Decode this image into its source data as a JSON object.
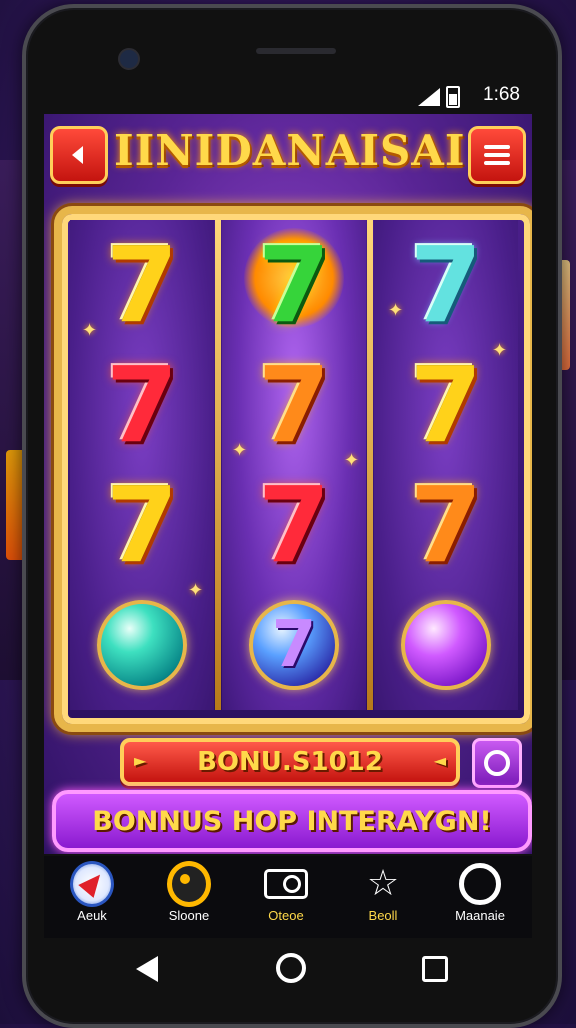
{
  "status_bar": {
    "time": "1:68"
  },
  "game": {
    "title": "IINIDANAISAI",
    "back_icon": "chevron-left-icon",
    "menu_icon": "hamburger-menu-icon",
    "accent_color": "#ffd94a",
    "frame_color": "#e7b64a"
  },
  "reels": [
    {
      "symbols": [
        {
          "kind": "seven",
          "color": "yellow",
          "text": "7"
        },
        {
          "kind": "seven",
          "color": "red",
          "text": "7"
        },
        {
          "kind": "seven",
          "color": "yellow",
          "text": "7"
        },
        {
          "kind": "orb",
          "color": "teal",
          "text": ""
        }
      ]
    },
    {
      "symbols": [
        {
          "kind": "seven",
          "color": "green",
          "text": "7"
        },
        {
          "kind": "seven",
          "color": "orange",
          "text": "7"
        },
        {
          "kind": "seven",
          "color": "red",
          "text": "7"
        },
        {
          "kind": "orb",
          "color": "mixed",
          "text": "7"
        }
      ]
    },
    {
      "symbols": [
        {
          "kind": "seven",
          "color": "cyan",
          "text": "7"
        },
        {
          "kind": "seven",
          "color": "yellow",
          "text": "7"
        },
        {
          "kind": "seven",
          "color": "orange",
          "text": "7"
        },
        {
          "kind": "orb",
          "color": "purple",
          "text": ""
        }
      ]
    }
  ],
  "bonus": {
    "label": "BONU.S1012"
  },
  "promo": {
    "label": "BONNUS HOP INTERAYGN!"
  },
  "bottom_nav": [
    {
      "label": "Aeuk",
      "icon": "compass-icon"
    },
    {
      "label": "Sloone",
      "icon": "coin-icon"
    },
    {
      "label": "Oteoe",
      "icon": "ticket-icon"
    },
    {
      "label": "Beoll",
      "icon": "star-icon"
    },
    {
      "label": "Maanaie",
      "icon": "ring-icon"
    }
  ],
  "system_nav": {
    "back_icon": "triangle-back-icon",
    "home_icon": "circle-home-icon",
    "recent_icon": "square-recent-icon"
  }
}
